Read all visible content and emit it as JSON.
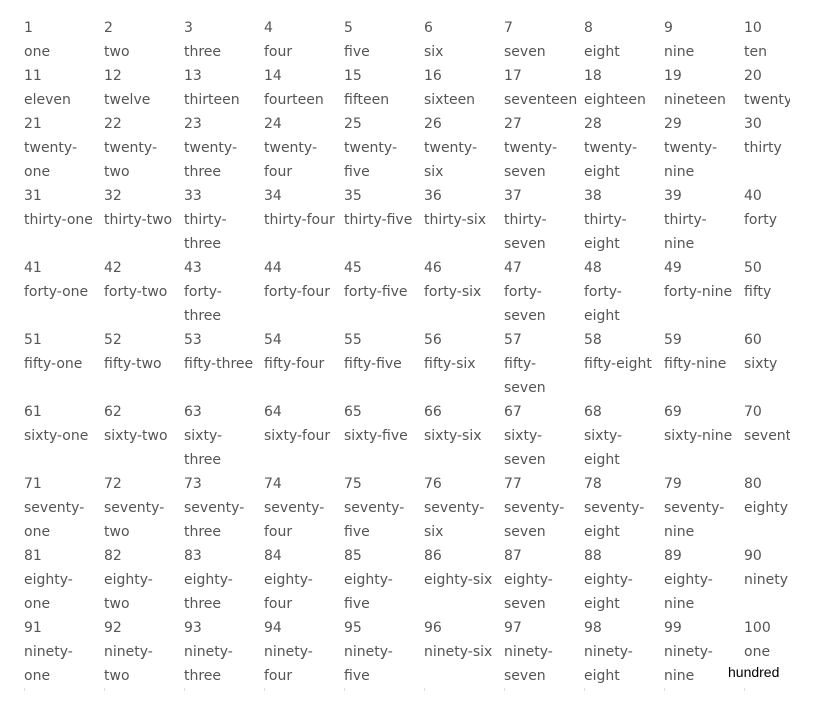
{
  "cells": [
    {
      "n": "1",
      "w": "one"
    },
    {
      "n": "2",
      "w": "two"
    },
    {
      "n": "3",
      "w": "three"
    },
    {
      "n": "4",
      "w": "four"
    },
    {
      "n": "5",
      "w": "five"
    },
    {
      "n": "6",
      "w": "six"
    },
    {
      "n": "7",
      "w": "seven"
    },
    {
      "n": "8",
      "w": "eight"
    },
    {
      "n": "9",
      "w": "nine"
    },
    {
      "n": "10",
      "w": "ten"
    },
    {
      "n": "11",
      "w": "eleven"
    },
    {
      "n": "12",
      "w": "twelve"
    },
    {
      "n": "13",
      "w": "thirteen"
    },
    {
      "n": "14",
      "w": "fourteen"
    },
    {
      "n": "15",
      "w": "fifteen"
    },
    {
      "n": "16",
      "w": "sixteen"
    },
    {
      "n": "17",
      "w": "seventeen"
    },
    {
      "n": "18",
      "w": "eighteen"
    },
    {
      "n": "19",
      "w": "nineteen"
    },
    {
      "n": "20",
      "w": "twenty"
    },
    {
      "n": "21",
      "w": "twenty-one"
    },
    {
      "n": "22",
      "w": "twenty-two"
    },
    {
      "n": "23",
      "w": "twenty-three"
    },
    {
      "n": "24",
      "w": "twenty-four"
    },
    {
      "n": "25",
      "w": "twenty-five"
    },
    {
      "n": "26",
      "w": "twenty-six"
    },
    {
      "n": "27",
      "w": "twenty-seven"
    },
    {
      "n": "28",
      "w": "twenty-eight"
    },
    {
      "n": "29",
      "w": "twenty-nine"
    },
    {
      "n": "30",
      "w": "thirty"
    },
    {
      "n": "31",
      "w": "thirty-one"
    },
    {
      "n": "32",
      "w": "thirty-two"
    },
    {
      "n": "33",
      "w": "thirty-three"
    },
    {
      "n": "34",
      "w": "thirty-four"
    },
    {
      "n": "35",
      "w": "thirty-five"
    },
    {
      "n": "36",
      "w": "thirty-six"
    },
    {
      "n": "37",
      "w": "thirty-seven"
    },
    {
      "n": "38",
      "w": "thirty-eight"
    },
    {
      "n": "39",
      "w": "thirty-nine"
    },
    {
      "n": "40",
      "w": "forty"
    },
    {
      "n": "41",
      "w": "forty-one"
    },
    {
      "n": "42",
      "w": "forty-two"
    },
    {
      "n": "43",
      "w": "forty-three"
    },
    {
      "n": "44",
      "w": "forty-four"
    },
    {
      "n": "45",
      "w": "forty-five"
    },
    {
      "n": "46",
      "w": "forty-six"
    },
    {
      "n": "47",
      "w": "forty-seven"
    },
    {
      "n": "48",
      "w": "forty-eight"
    },
    {
      "n": "49",
      "w": "forty-nine"
    },
    {
      "n": "50",
      "w": "fifty"
    },
    {
      "n": "51",
      "w": "fifty-one"
    },
    {
      "n": "52",
      "w": "fifty-two"
    },
    {
      "n": "53",
      "w": "fifty-three"
    },
    {
      "n": "54",
      "w": "fifty-four"
    },
    {
      "n": "55",
      "w": "fifty-five"
    },
    {
      "n": "56",
      "w": "fifty-six"
    },
    {
      "n": "57",
      "w": "fifty-seven"
    },
    {
      "n": "58",
      "w": "fifty-eight"
    },
    {
      "n": "59",
      "w": "fifty-nine"
    },
    {
      "n": "60",
      "w": "sixty"
    },
    {
      "n": "61",
      "w": "sixty-one"
    },
    {
      "n": "62",
      "w": "sixty-two"
    },
    {
      "n": "63",
      "w": "sixty-three"
    },
    {
      "n": "64",
      "w": "sixty-four"
    },
    {
      "n": "65",
      "w": "sixty-five"
    },
    {
      "n": "66",
      "w": "sixty-six"
    },
    {
      "n": "67",
      "w": "sixty-seven"
    },
    {
      "n": "68",
      "w": "sixty-eight"
    },
    {
      "n": "69",
      "w": "sixty-nine"
    },
    {
      "n": "70",
      "w": "seventy"
    },
    {
      "n": "71",
      "w": "seventy-one"
    },
    {
      "n": "72",
      "w": "seventy-two"
    },
    {
      "n": "73",
      "w": "seventy-three"
    },
    {
      "n": "74",
      "w": "seventy-four"
    },
    {
      "n": "75",
      "w": "seventy-five"
    },
    {
      "n": "76",
      "w": "seventy-six"
    },
    {
      "n": "77",
      "w": "seventy-seven"
    },
    {
      "n": "78",
      "w": "seventy-eight"
    },
    {
      "n": "79",
      "w": "seventy-nine"
    },
    {
      "n": "80",
      "w": "eighty"
    },
    {
      "n": "81",
      "w": "eighty-one"
    },
    {
      "n": "82",
      "w": "eighty-two"
    },
    {
      "n": "83",
      "w": "eighty-three"
    },
    {
      "n": "84",
      "w": "eighty-four"
    },
    {
      "n": "85",
      "w": "eighty-five"
    },
    {
      "n": "86",
      "w": "eighty-six"
    },
    {
      "n": "87",
      "w": "eighty-seven"
    },
    {
      "n": "88",
      "w": "eighty-eight"
    },
    {
      "n": "89",
      "w": "eighty-nine"
    },
    {
      "n": "90",
      "w": "ninety"
    },
    {
      "n": "91",
      "w": "ninety-one"
    },
    {
      "n": "92",
      "w": "ninety-two"
    },
    {
      "n": "93",
      "w": "ninety-three"
    },
    {
      "n": "94",
      "w": "ninety-four"
    },
    {
      "n": "95",
      "w": "ninety-five"
    },
    {
      "n": "96",
      "w": "ninety-six"
    },
    {
      "n": "97",
      "w": "ninety-seven"
    },
    {
      "n": "98",
      "w": "ninety-eight"
    },
    {
      "n": "99",
      "w": "ninety-nine"
    },
    {
      "n": "100",
      "w": "one"
    }
  ],
  "hundred_overflow": "hundred",
  "colors": {
    "text": "#555555",
    "overflow_text": "#000000"
  }
}
